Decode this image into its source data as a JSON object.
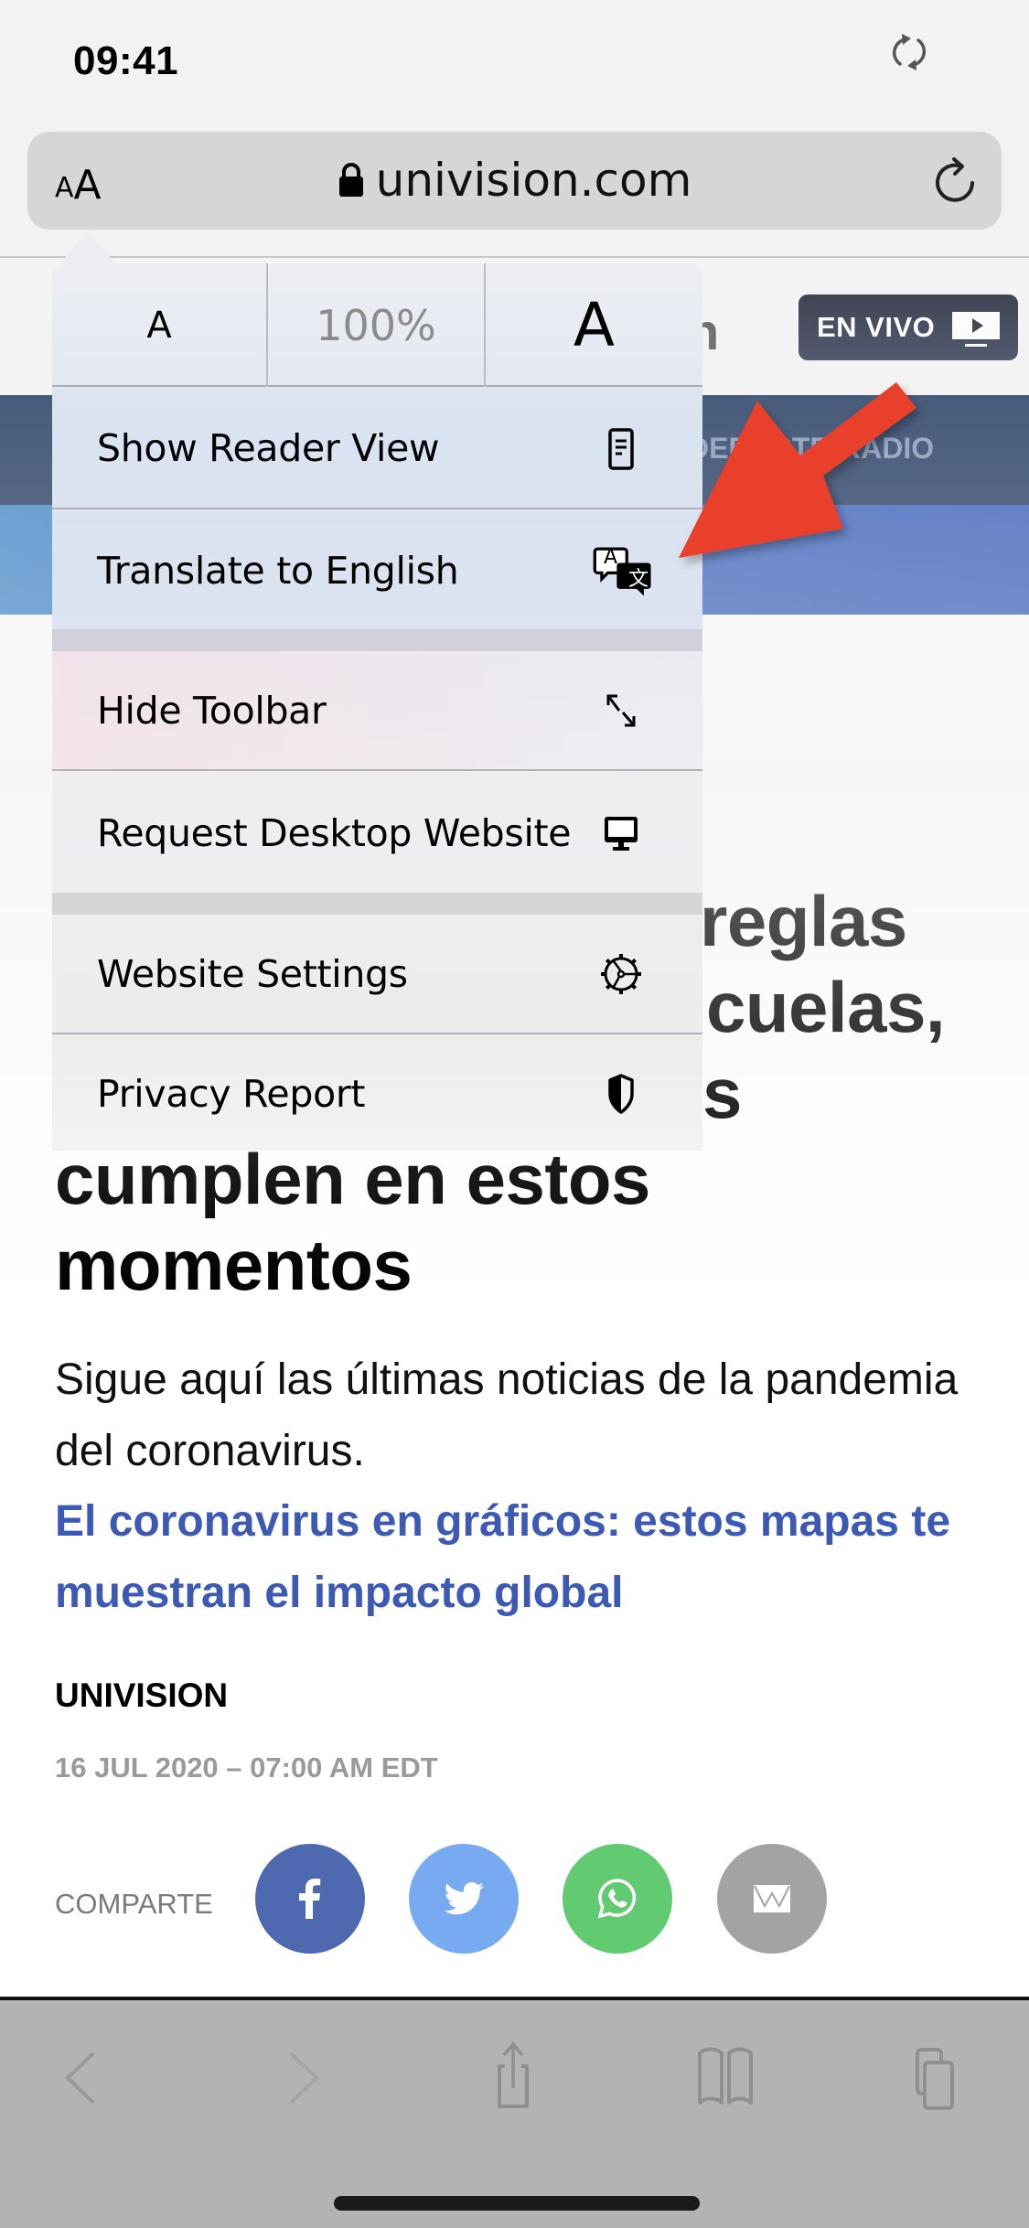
{
  "status_bar": {
    "time": "09:41",
    "orientation_lock_icon": "orientation-lock-icon"
  },
  "address_bar": {
    "text_size_button": {
      "small": "A",
      "large": "A"
    },
    "url": "univision.com",
    "secure_icon": "lock-icon",
    "reload_icon": "reload-icon"
  },
  "page_menu": {
    "font_controls": {
      "smaller_label": "A",
      "zoom_level": "100%",
      "larger_label": "A"
    },
    "groups": [
      {
        "items": [
          {
            "label": "Show Reader View",
            "icon": "reader-view-icon"
          },
          {
            "label": "Translate to English",
            "icon": "translate-icon",
            "icon_glyphs": [
              "A",
              "文"
            ]
          }
        ]
      },
      {
        "items": [
          {
            "label": "Hide Toolbar",
            "icon": "expand-arrows-icon"
          },
          {
            "label": "Request Desktop Website",
            "icon": "desktop-icon"
          }
        ]
      },
      {
        "items": [
          {
            "label": "Website Settings",
            "icon": "gear-icon"
          },
          {
            "label": "Privacy Report",
            "icon": "shield-icon"
          }
        ]
      }
    ]
  },
  "annotation": {
    "type": "arrow",
    "color": "#e8412a",
    "points_to": "Translate to English"
  },
  "webpage": {
    "logo_fragment": "n",
    "live_button": {
      "label": "EN VIVO",
      "icon": "tv-play-icon"
    },
    "nav_items": [
      "DEPORTES",
      "RADIO"
    ],
    "headline_visible_fragments": [
      "reglas",
      "cuelas,",
      "s"
    ],
    "headline_lines": [
      "cumplen en estos",
      "momentos"
    ],
    "summary": "Sigue aquí las últimas noticias de la pandemia del coronavirus.",
    "related_link": "El coronavirus en gráficos: estos mapas te muestran el impacto global",
    "author": "UNIVISION",
    "dateline": "16 JUL 2020 – 07:00 AM EDT",
    "share": {
      "label": "COMPARTE",
      "buttons": [
        {
          "network": "facebook",
          "icon": "facebook-icon",
          "color": "#4e69b0"
        },
        {
          "network": "twitter",
          "icon": "twitter-icon",
          "color": "#77aaf0"
        },
        {
          "network": "whatsapp",
          "icon": "whatsapp-icon",
          "color": "#62cb72"
        },
        {
          "network": "email",
          "icon": "mail-icon",
          "color": "#a3a3a3"
        }
      ]
    },
    "colors": {
      "nav_band": "#17305a",
      "link": "#3c5ab5",
      "banner": "#335fb9"
    }
  },
  "toolbar": {
    "buttons": [
      {
        "name": "back",
        "icon": "chevron-left-icon",
        "enabled": false
      },
      {
        "name": "forward",
        "icon": "chevron-right-icon",
        "enabled": false
      },
      {
        "name": "share",
        "icon": "share-icon",
        "enabled": true
      },
      {
        "name": "bookmarks",
        "icon": "book-icon",
        "enabled": true
      },
      {
        "name": "tabs",
        "icon": "tabs-icon",
        "enabled": true
      }
    ]
  }
}
